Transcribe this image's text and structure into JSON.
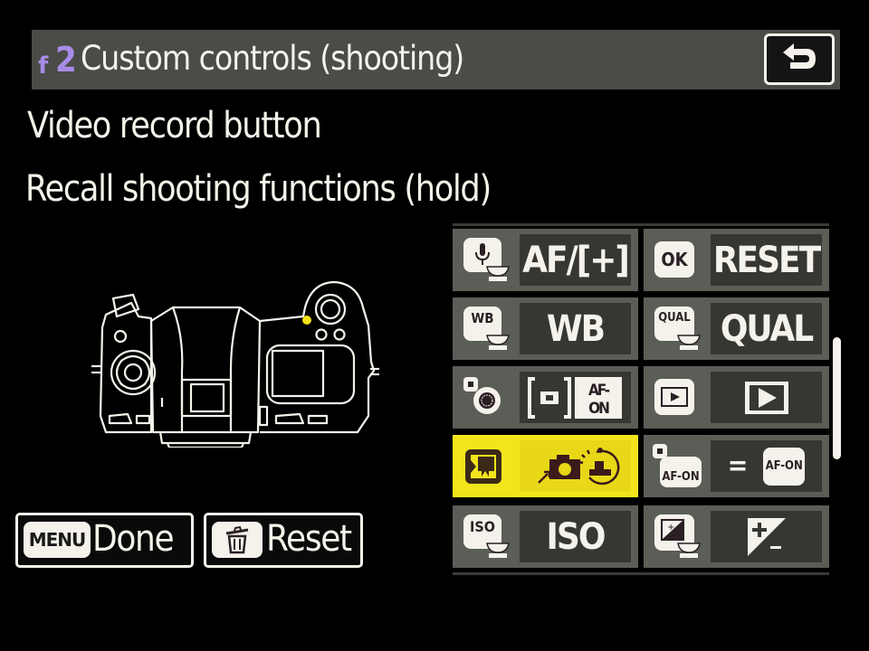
{
  "header": {
    "menu_letter": "f",
    "menu_number": "2",
    "title": "Custom controls (shooting)",
    "back_icon": "return-arrow-icon"
  },
  "control_name": "Video record button",
  "assigned_function": "Recall shooting functions (hold)",
  "camera_diagram": {
    "view": "camera-top-view",
    "highlight_color": "#f2e21a"
  },
  "grid": {
    "selected_index": 6,
    "items": [
      {
        "icon": "mic-press-dial-icon",
        "value": "AF/[+]"
      },
      {
        "icon": "ok-button-icon",
        "icon_text": "OK",
        "value": "RESET"
      },
      {
        "icon": "wb-press-dial-icon",
        "icon_text": "WB",
        "value": "WB"
      },
      {
        "icon": "qual-press-dial-icon",
        "icon_text": "QUAL",
        "value": "QUAL"
      },
      {
        "icon": "subselector-center-icon",
        "value": "[+] AF-ON",
        "value_text": "AF-\nON"
      },
      {
        "icon": "playback-button-icon",
        "value": "playback-icon"
      },
      {
        "icon": "video-record-button-icon",
        "value": "recall-shooting-functions-hold-icon"
      },
      {
        "icon": "af-on-button-icon",
        "icon_text": "AF-ON",
        "value": "= AF-ON",
        "value_text": "AF-ON"
      },
      {
        "icon": "iso-press-dial-icon",
        "icon_text": "ISO",
        "value": "ISO"
      },
      {
        "icon": "exposure-comp-press-dial-icon",
        "value": "exposure-compensation-icon"
      }
    ]
  },
  "scrollbar": {
    "position_fraction": 0.32,
    "visible_fraction": 0.35
  },
  "footer": {
    "done": {
      "key": "MENU",
      "label": "Done"
    },
    "reset": {
      "key": "trash-icon",
      "label": "Reset"
    }
  },
  "colors": {
    "accent_selected": "#f3e51c",
    "menu_number": "#a98ce8",
    "title_bar": "#4a4c47"
  }
}
